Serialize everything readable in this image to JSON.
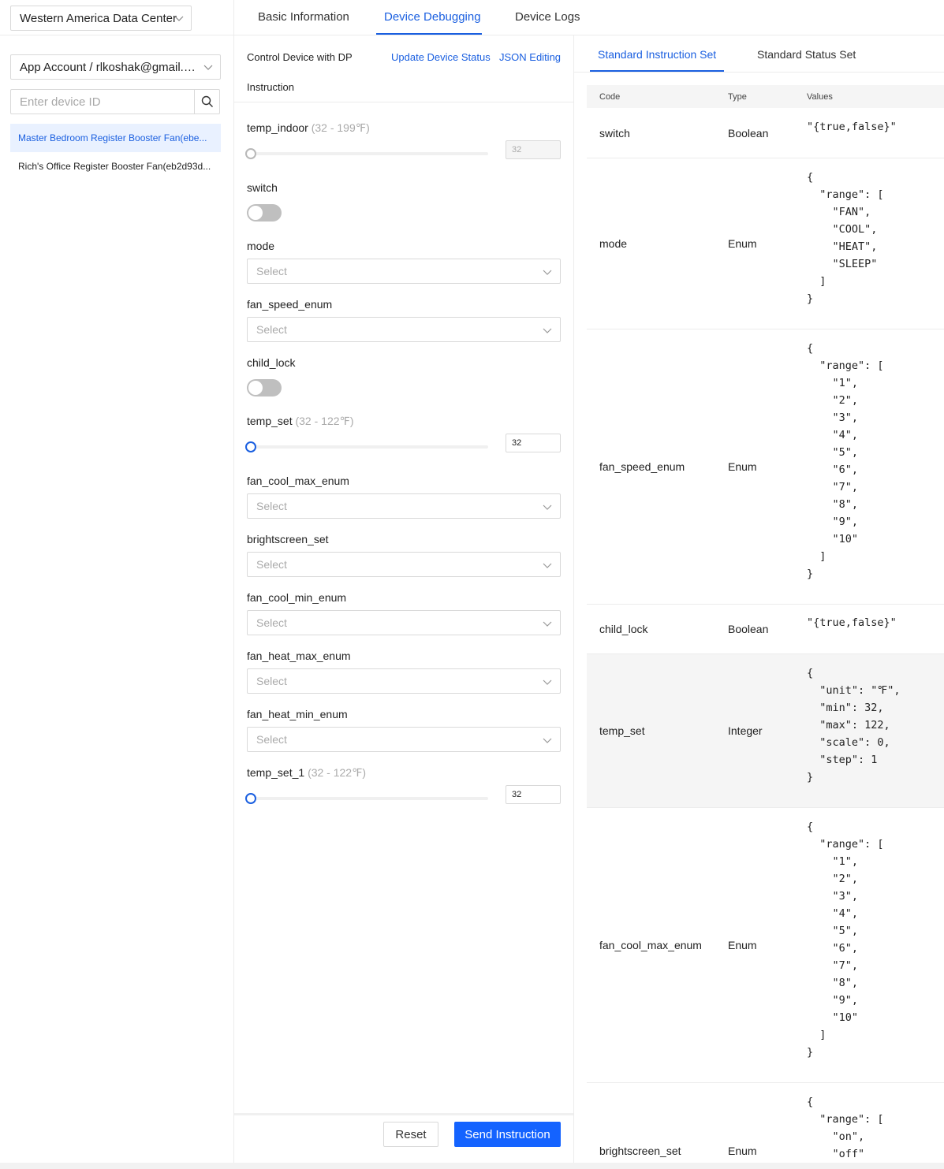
{
  "sidebar": {
    "data_center": "Western America Data Center",
    "account": "App Account / rlkoshak@gmail.com",
    "search_placeholder": "Enter device ID",
    "devices": [
      {
        "label": "Master Bedroom Register Booster Fan(ebe...",
        "active": true
      },
      {
        "label": "Rich's Office Register Booster Fan(eb2d93d...",
        "active": false
      }
    ]
  },
  "tabs": [
    "Basic Information",
    "Device Debugging",
    "Device Logs"
  ],
  "active_tab": "Device Debugging",
  "control": {
    "title_line1": "Control Device with DP",
    "title_line2": "Instruction",
    "update_status": "Update Device Status",
    "json_editing": "JSON Editing",
    "fields": {
      "temp_indoor": {
        "label": "temp_indoor",
        "range": "(32 - 199℉)",
        "value": "32"
      },
      "switch": {
        "label": "switch"
      },
      "mode": {
        "label": "mode",
        "placeholder": "Select"
      },
      "fan_speed_enum": {
        "label": "fan_speed_enum",
        "placeholder": "Select"
      },
      "child_lock": {
        "label": "child_lock"
      },
      "temp_set": {
        "label": "temp_set",
        "range": "(32 - 122℉)",
        "value": "32"
      },
      "fan_cool_max_enum": {
        "label": "fan_cool_max_enum",
        "placeholder": "Select"
      },
      "brightscreen_set": {
        "label": "brightscreen_set",
        "placeholder": "Select"
      },
      "fan_cool_min_enum": {
        "label": "fan_cool_min_enum",
        "placeholder": "Select"
      },
      "fan_heat_max_enum": {
        "label": "fan_heat_max_enum",
        "placeholder": "Select"
      },
      "fan_heat_min_enum": {
        "label": "fan_heat_min_enum",
        "placeholder": "Select"
      },
      "temp_set_1": {
        "label": "temp_set_1",
        "range": "(32 - 122℉)",
        "value": "32"
      }
    },
    "reset": "Reset",
    "send": "Send Instruction"
  },
  "instruction_set": {
    "tabs": [
      "Standard Instruction Set",
      "Standard Status Set"
    ],
    "columns": [
      "Code",
      "Type",
      "Values"
    ],
    "rows": [
      {
        "code": "switch",
        "type": "Boolean",
        "values": "\"{true,false}\""
      },
      {
        "code": "mode",
        "type": "Enum",
        "values": "{\n  \"range\": [\n    \"FAN\",\n    \"COOL\",\n    \"HEAT\",\n    \"SLEEP\"\n  ]\n}"
      },
      {
        "code": "fan_speed_enum",
        "type": "Enum",
        "values": "{\n  \"range\": [\n    \"1\",\n    \"2\",\n    \"3\",\n    \"4\",\n    \"5\",\n    \"6\",\n    \"7\",\n    \"8\",\n    \"9\",\n    \"10\"\n  ]\n}"
      },
      {
        "code": "child_lock",
        "type": "Boolean",
        "values": "\"{true,false}\""
      },
      {
        "code": "temp_set",
        "type": "Integer",
        "values": "{\n  \"unit\": \"℉\",\n  \"min\": 32,\n  \"max\": 122,\n  \"scale\": 0,\n  \"step\": 1\n}"
      },
      {
        "code": "fan_cool_max_enum",
        "type": "Enum",
        "values": "{\n  \"range\": [\n    \"1\",\n    \"2\",\n    \"3\",\n    \"4\",\n    \"5\",\n    \"6\",\n    \"7\",\n    \"8\",\n    \"9\",\n    \"10\"\n  ]\n}"
      },
      {
        "code": "brightscreen_set",
        "type": "Enum",
        "values": "{\n  \"range\": [\n    \"on\",\n    \"off\""
      }
    ]
  },
  "colors": {
    "accent": "#1a5fe0",
    "primary_button": "#1463ff",
    "highlight_row": "#f5f5f5"
  }
}
